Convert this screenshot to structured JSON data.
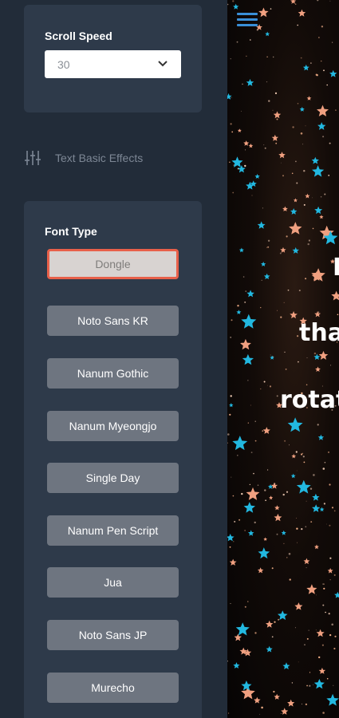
{
  "sidebar": {
    "scroll_speed": {
      "label": "Scroll Speed",
      "value": "30"
    },
    "section_title": "Text Basic Effects",
    "font_type": {
      "label": "Font Type",
      "selected": "Dongle",
      "options": [
        "Dongle",
        "Noto Sans KR",
        "Nanum Gothic",
        "Nanum Myeongjo",
        "Single Day",
        "Nanum Pen Script",
        "Jua",
        "Noto Sans JP",
        "Murecho"
      ]
    }
  },
  "stage": {
    "lines": [
      "M",
      "tha",
      "rotat"
    ]
  },
  "colors": {
    "accent": "#e8604a",
    "panel": "#2e3a4a",
    "sidebar": "#222c39",
    "star_orange": "#f0a080",
    "star_cyan": "#22b8e0",
    "menu": "#3a8fd8"
  },
  "icons": {
    "menu": "hamburger-icon",
    "section": "sliders-icon",
    "select": "chevron-down-icon"
  }
}
